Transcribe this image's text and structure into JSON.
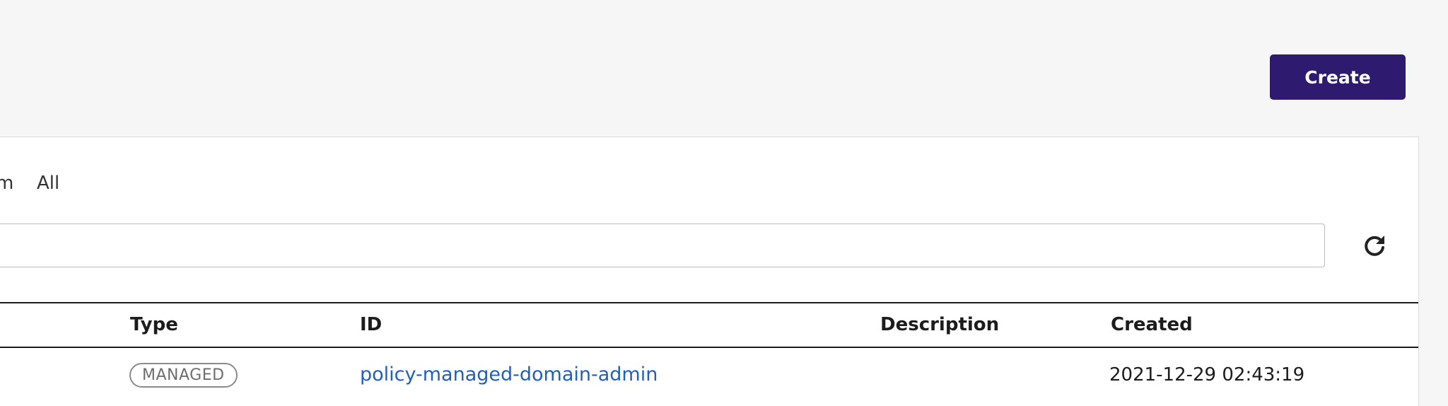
{
  "header": {
    "create_label": "Create"
  },
  "filters": {
    "tabs": [
      {
        "label": "m"
      },
      {
        "label": "All"
      }
    ]
  },
  "search": {
    "value": "",
    "placeholder": ""
  },
  "toolbar": {
    "refresh_icon": "refresh-icon"
  },
  "table": {
    "columns": [
      "Type",
      "ID",
      "Description",
      "Created"
    ],
    "rows": [
      {
        "type": "MANAGED",
        "id": "policy-managed-domain-admin",
        "description": "",
        "created": "2021-12-29 02:43:19"
      }
    ]
  },
  "colors": {
    "brand": "#2e1a6e",
    "link": "#1f5fbf",
    "badge_border": "#8a8a8a"
  }
}
